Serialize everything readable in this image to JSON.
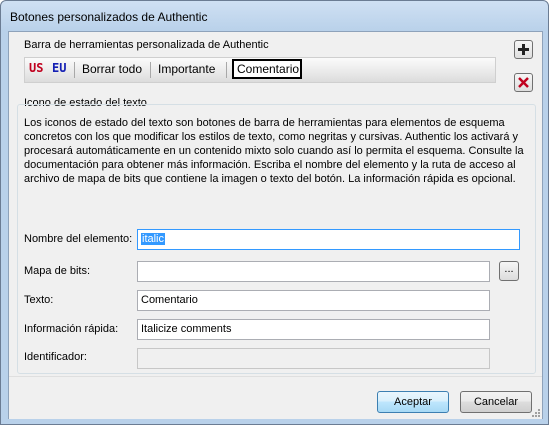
{
  "window": {
    "title": "Botones personalizados de Authentic"
  },
  "toolbar_group": {
    "label": "Barra de herramientas personalizada de Authentic",
    "items": [
      {
        "id": "us",
        "label": "US",
        "color": "#c0001e"
      },
      {
        "id": "eu",
        "label": "EU",
        "color": "#1520b4"
      },
      {
        "id": "borrar",
        "label": "Borrar todo"
      },
      {
        "id": "importante",
        "label": "Importante"
      },
      {
        "id": "comentario",
        "label": "Comentario",
        "selected": true
      }
    ],
    "add_icon": "plus-icon",
    "delete_icon": "delete-x-icon"
  },
  "status_group": {
    "label": "Icono de estado del texto",
    "description": "Los iconos de estado del texto son botones de barra de herramientas para elementos de esquema concretos con los que modificar los estilos de texto, como negritas y cursivas. Authentic los activará y procesará automáticamente en un contenido mixto solo cuando así lo permita el esquema. Consulte la documentación para obtener más información. Escriba el nombre del elemento y la ruta de acceso al archivo de mapa de bits que contiene la imagen o texto del botón. La información rápida es opcional."
  },
  "fields": {
    "element_name": {
      "label": "Nombre del elemento:",
      "value": "italic"
    },
    "bitmap": {
      "label": "Mapa de bits:",
      "value": "",
      "browse_label": "..."
    },
    "text": {
      "label": "Texto:",
      "value": "Comentario"
    },
    "tooltip": {
      "label": "Información rápida:",
      "value": "Italicize comments"
    },
    "identifier": {
      "label": "Identificador:",
      "value": ""
    }
  },
  "buttons": {
    "ok": "Aceptar",
    "cancel": "Cancelar"
  },
  "colors": {
    "accent": "#3399ff",
    "title_bg": "#b9d1ea"
  }
}
